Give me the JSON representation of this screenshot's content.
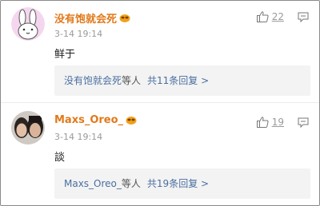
{
  "comments": [
    {
      "username": "没有饱就会死",
      "timestamp": "3-14 19:14",
      "content": "鲜于",
      "likes": "22",
      "thread": {
        "names": "没有饱就会死",
        "suffix": "等人",
        "count": "共11条回复 >"
      }
    },
    {
      "username": "Maxs_Oreo_",
      "timestamp": "3-14 19:14",
      "content": "談",
      "likes": "19",
      "thread": {
        "names": "Maxs_Oreo_",
        "suffix": "等人",
        "count": "共19条回复 >"
      }
    }
  ],
  "colors": {
    "username": "#e1791a",
    "link": "#4a6fa0",
    "muted": "#9a9a9a",
    "thread_bg": "#f3f3f3"
  },
  "icons": [
    "bunny-avatar-icon",
    "user-photo-avatar",
    "vip-badge-icon",
    "thumb-up-icon",
    "reply-icon"
  ]
}
